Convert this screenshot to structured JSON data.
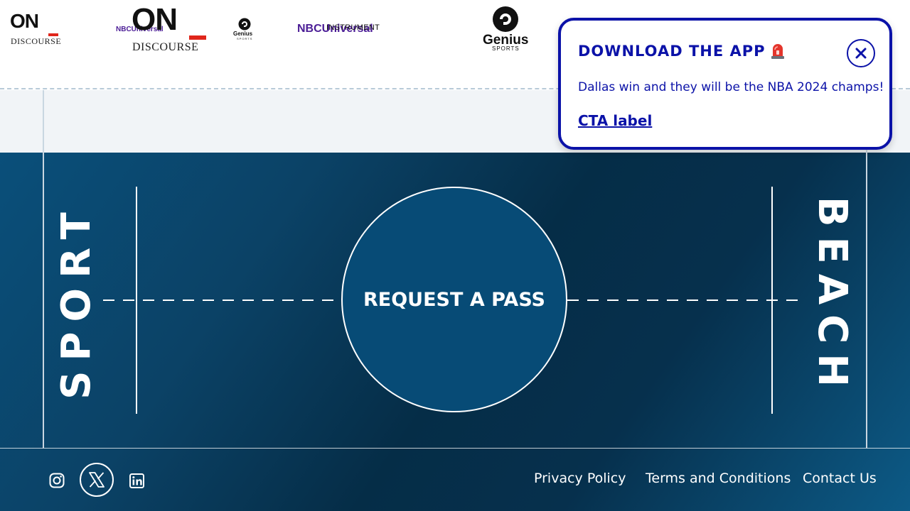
{
  "colors": {
    "accent": "#0b12a8",
    "court_dark": "#052d47",
    "court_light": "#0a4f7a",
    "band": "#f1f4f7",
    "logo_red": "#e0261b",
    "nbc_purple": "#4b1d96"
  },
  "logos": {
    "on_discourse": {
      "on": "ON",
      "discourse": "DISCOURSE"
    },
    "nbc": {
      "nbcu": "NBCU",
      "universal": "NBCUniversal",
      "instrument": "INSTRUMENT"
    },
    "genius": {
      "name": "Genius",
      "sports": "SPORTS"
    }
  },
  "court": {
    "left_label": "SPORT",
    "right_label": "BEACH",
    "cta_button": "REQUEST A PASS"
  },
  "footer": {
    "social": [
      {
        "name": "instagram",
        "icon": "instagram-icon"
      },
      {
        "name": "x",
        "icon": "x-icon"
      },
      {
        "name": "linkedin",
        "icon": "linkedin-icon"
      }
    ],
    "links": [
      "Privacy Policy",
      "Terms and Conditions",
      "Contact Us"
    ]
  },
  "toast": {
    "title": "DOWNLOAD THE APP",
    "title_emoji_icon": "siren-icon",
    "message": "Dallas win and they will be the NBA 2024 champs!",
    "cta": "CTA label",
    "close_icon": "close-icon"
  }
}
